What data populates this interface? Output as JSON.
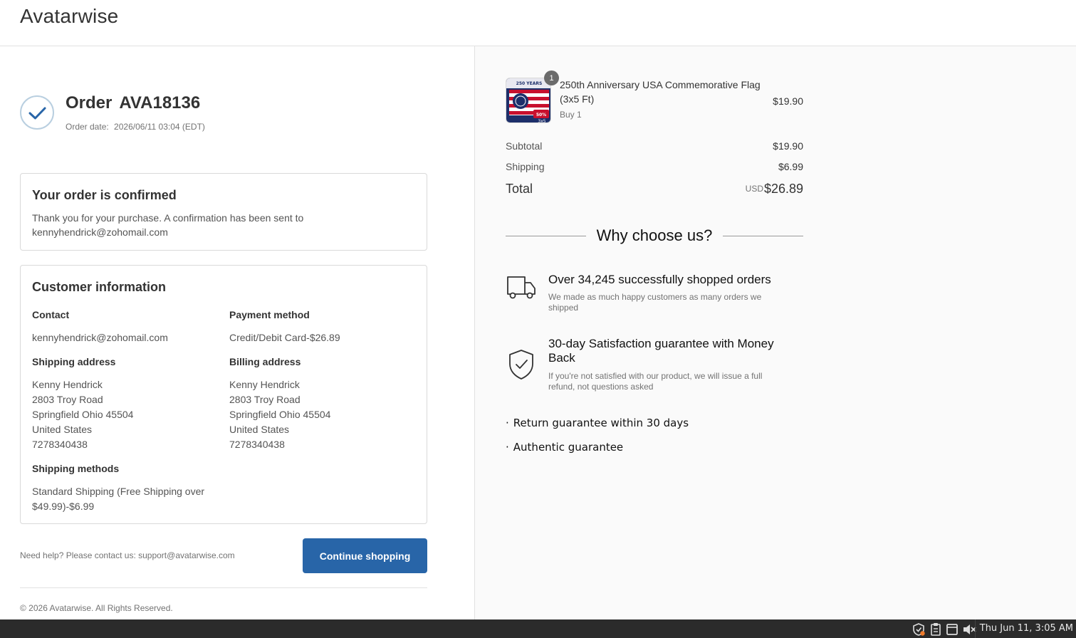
{
  "header": {
    "brand": "Avatarwise"
  },
  "order": {
    "label": "Order",
    "number": "AVA18136",
    "date_label": "Order date:",
    "date_value": "2026/06/11 03:04 (EDT)"
  },
  "confirmation": {
    "title": "Your order is confirmed",
    "text_line1": "Thank you for your purchase. A confirmation has been sent to",
    "text_line2": "kennyhendrick@zohomail.com"
  },
  "customer": {
    "title": "Customer information",
    "contact": {
      "label": "Contact",
      "value": "kennyhendrick@zohomail.com"
    },
    "payment": {
      "label": "Payment method",
      "value": "Credit/Debit Card-$26.89"
    },
    "shipping_address": {
      "label": "Shipping address",
      "lines": [
        "Kenny Hendrick",
        "2803 Troy Road",
        "Springfield Ohio 45504",
        "United States",
        "7278340438"
      ]
    },
    "billing_address": {
      "label": "Billing address",
      "lines": [
        "Kenny Hendrick",
        "2803 Troy Road",
        "Springfield Ohio 45504",
        "United States",
        "7278340438"
      ]
    },
    "shipping_methods": {
      "label": "Shipping methods",
      "lines": [
        "Standard Shipping (Free Shipping over",
        "$49.99)-$6.99"
      ]
    }
  },
  "footer": {
    "help": "Need help? Please contact us: support@avatarwise.com",
    "continue_button": "Continue shopping",
    "copyright": "© 2026 Avatarwise. All Rights Reserved."
  },
  "cart": {
    "item": {
      "name_line1": "250th Anniversary USA Commemorative Flag",
      "name_line2": "(3x5 Ft)",
      "variant": "Buy 1",
      "price": "$19.90",
      "quantity": "1",
      "thumb_text_top": "250 YEARS",
      "thumb_text_badge": "50%",
      "thumb_text_size": "3x5"
    },
    "subtotal_label": "Subtotal",
    "subtotal": "$19.90",
    "shipping_label": "Shipping",
    "shipping": "$6.99",
    "total_label": "Total",
    "currency": "USD",
    "total": "$26.89"
  },
  "why": {
    "title": "Why choose us?",
    "features": [
      {
        "icon": "truck-icon",
        "title": "Over 34,245 successfully shopped orders",
        "desc_line1": "We made as much happy customers as many orders we",
        "desc_line2": "shipped"
      },
      {
        "icon": "shield-check-icon",
        "title_line1": "30-day Satisfaction guarantee with Money",
        "title_line2": "Back",
        "desc_line1": "If you're not satisfied with our product, we will issue a full",
        "desc_line2": "refund, not questions asked"
      }
    ],
    "bullets": [
      "Return guarantee within 30 days",
      "Authentic guarantee"
    ]
  },
  "taskbar": {
    "clock": "Thu Jun 11,  3:05 AM"
  },
  "colors": {
    "primary_button": "#2865a8",
    "check_ring": "#b9cfe0",
    "check_mark": "#2865a8"
  }
}
